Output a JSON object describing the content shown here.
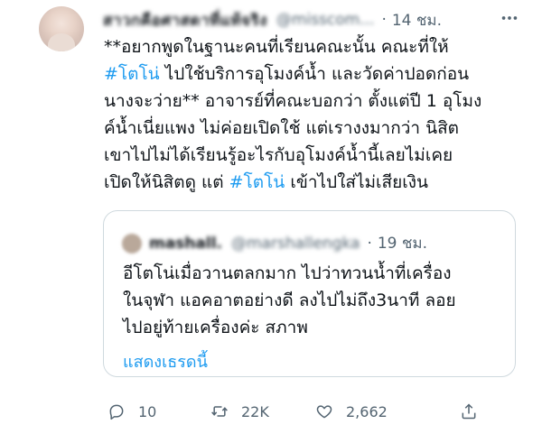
{
  "tweet": {
    "author_name": "สาวกคือศาสดาที่แท้จริง",
    "author_handle": "@misscom...",
    "time": "14 ชม.",
    "lines": [
      [
        {
          "t": "**อยากพูดในฐานะคนที่เรียนคณะนั้น คณะที่ให้"
        }
      ],
      [
        {
          "t": "#โตโน่",
          "hl": true
        },
        {
          "t": " ไปใช้บริการอุโมงค์น้ำ และวัดค่าปอดก่อน"
        }
      ],
      [
        {
          "t": "นางจะว่าย** อาจารย์ที่คณะบอกว่า ตั้งแต่ปี 1 อุโมง"
        }
      ],
      [
        {
          "t": "ค์น้ำเนี่ยแพง ไม่ค่อยเปิดใช้ แต่เรางงมากว่า นิสิต"
        }
      ],
      [
        {
          "t": "เขาไปไม่ได้เรียนรู้อะไรกับอุโมงค์น้ำนี้เลยไม่เคย"
        }
      ],
      [
        {
          "t": "เปิดให้นิสิตดู แต่ "
        },
        {
          "t": "#โตโน่",
          "hl": true
        },
        {
          "t": " เข้าไปใส่ไม่เสียเงิน"
        }
      ]
    ]
  },
  "quote": {
    "author_name": "mashall.",
    "author_handle": "@marshallengka",
    "time": "19 ชม.",
    "lines": [
      "อีโตโน่เมื่อวานตลกมาก ไปว่าทวนน้ำที่เครื่อง",
      "ในจุฬา แอคอาตอย่างดี ลงไปไม่ถึง3นาที ลอย",
      "ไปอยู่ท้ายเครื่องค่ะ สภาพ"
    ],
    "show_thread": "แสดงเธรดนี้"
  },
  "actions": {
    "reply_count": "10",
    "retweet_count": "22K",
    "like_count": "2,662"
  },
  "colors": {
    "link": "#1d9bf0",
    "muted": "#536471",
    "border": "#cfd9de"
  },
  "icons": [
    "reply-icon",
    "retweet-icon",
    "like-icon",
    "share-icon",
    "more-icon"
  ]
}
